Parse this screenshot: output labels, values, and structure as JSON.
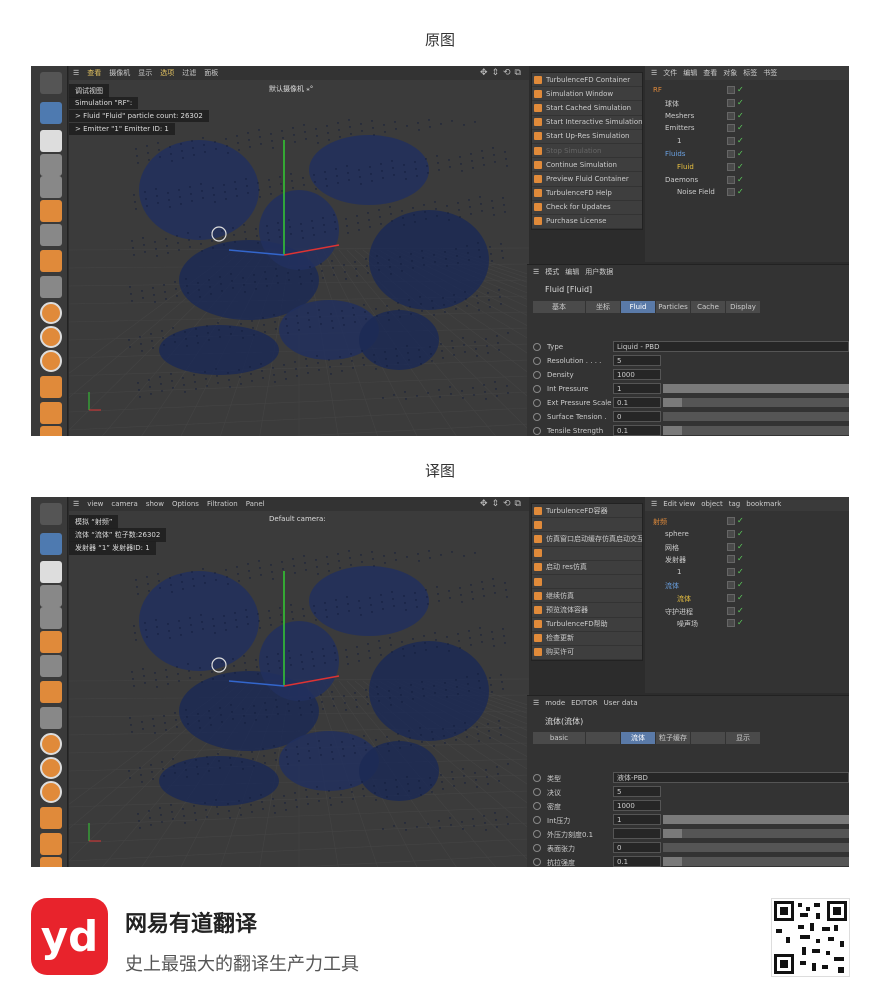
{
  "captions": {
    "original": "原图",
    "translated": "译图"
  },
  "original": {
    "menu": [
      "查看",
      "摄像机",
      "显示",
      "选项",
      "过滤",
      "面板"
    ],
    "menu_active": [
      "查看",
      "选项"
    ],
    "hud": {
      "line1": "调试视图",
      "line2": "Simulation \"RF\":",
      "line3": "> Fluid \"Fluid\" particle count: 26302",
      "line4": "> Emitter \"1\" Emitter ID: 1"
    },
    "camera": "默认摄像机 ⁎°",
    "context_menu": [
      {
        "label": "TurbulenceFD Container",
        "disabled": false
      },
      {
        "label": "Simulation Window",
        "disabled": false
      },
      {
        "label": "Start Cached Simulation",
        "disabled": false
      },
      {
        "label": "Start Interactive Simulation",
        "disabled": false
      },
      {
        "label": "Start Up-Res Simulation",
        "disabled": false
      },
      {
        "label": "Stop Simulation",
        "disabled": true
      },
      {
        "label": "Continue Simulation",
        "disabled": false
      },
      {
        "label": "Preview Fluid Container",
        "disabled": false
      },
      {
        "label": "TurbulenceFD Help",
        "disabled": false
      },
      {
        "label": "Check for Updates",
        "disabled": false
      },
      {
        "label": "Purchase License",
        "disabled": false
      }
    ],
    "obj_menu": [
      "文件",
      "编辑",
      "查看",
      "对象",
      "标签",
      "书签"
    ],
    "objects": [
      {
        "name": "RF",
        "indent": 0,
        "color": "#e08a3a"
      },
      {
        "name": "球体",
        "indent": 1,
        "color": "#ccc"
      },
      {
        "name": "Meshers",
        "indent": 1,
        "color": "#ccc"
      },
      {
        "name": "Emitters",
        "indent": 1,
        "color": "#ccc"
      },
      {
        "name": "1",
        "indent": 2,
        "color": "#ccc"
      },
      {
        "name": "Fluids",
        "indent": 1,
        "color": "#6aa0e0"
      },
      {
        "name": "Fluid",
        "indent": 2,
        "color": "#e8c040"
      },
      {
        "name": "Daemons",
        "indent": 1,
        "color": "#ccc"
      },
      {
        "name": "Noise Field",
        "indent": 2,
        "color": "#ccc"
      }
    ],
    "attr_menu": [
      "模式",
      "编辑",
      "用户数据"
    ],
    "attr_title": "Fluid [Fluid]",
    "tabs": [
      "基本",
      "坐标",
      "Fluid",
      "Particles",
      "Cache",
      "Display"
    ],
    "active_tab": "Fluid",
    "params": [
      {
        "label": "Type",
        "value": "Liquid - PBD",
        "fill": null
      },
      {
        "label": "Resolution . . . .",
        "value": "5",
        "fill": null
      },
      {
        "label": "Density",
        "value": "1000",
        "fill": null
      },
      {
        "label": "Int Pressure",
        "value": "1",
        "fill": 1.0
      },
      {
        "label": "Ext Pressure Scale",
        "value": "0.1",
        "fill": 0.1
      },
      {
        "label": "Surface Tension .",
        "value": "0",
        "fill": 0.0
      },
      {
        "label": "Tensile Strength",
        "value": "0.1",
        "fill": 0.1
      }
    ]
  },
  "translated": {
    "menu": [
      "view",
      "camera",
      "show",
      "Options",
      "Filtration",
      "Panel"
    ],
    "hud": {
      "line1": "模拟 “射频”",
      "line2": "流体 “流体” 粒子数:26302",
      "line3": "发射器 “1” 发射器ID: 1"
    },
    "camera": "Default camera:",
    "context_menu": [
      {
        "label": "TurbulenceFD容器",
        "disabled": false
      },
      {
        "label": "",
        "disabled": false
      },
      {
        "label": "仿真窗口启动缓存仿真启动交互式仿真停止仿真",
        "disabled": false
      },
      {
        "label": "",
        "disabled": false
      },
      {
        "label": "启动 res仿真",
        "disabled": false
      },
      {
        "label": "",
        "disabled": true
      },
      {
        "label": "继续仿真",
        "disabled": false
      },
      {
        "label": "预览流体容器",
        "disabled": false
      },
      {
        "label": "TurbulenceFD帮助",
        "disabled": false
      },
      {
        "label": "检查更新",
        "disabled": false
      },
      {
        "label": "购买许可",
        "disabled": false
      }
    ],
    "obj_menu": [
      "Edit view",
      "object",
      "tag",
      "bookmark"
    ],
    "objects": [
      {
        "name": "射频",
        "indent": 0,
        "color": "#e08a3a"
      },
      {
        "name": "sphere",
        "indent": 1,
        "color": "#ccc"
      },
      {
        "name": "网格",
        "indent": 1,
        "color": "#ccc"
      },
      {
        "name": "发射器",
        "indent": 1,
        "color": "#ccc"
      },
      {
        "name": "1",
        "indent": 2,
        "color": "#ccc"
      },
      {
        "name": "流体",
        "indent": 1,
        "color": "#6aa0e0"
      },
      {
        "name": "流体",
        "indent": 2,
        "color": "#e8c040"
      },
      {
        "name": "守护进程",
        "indent": 1,
        "color": "#ccc"
      },
      {
        "name": "噪声场",
        "indent": 2,
        "color": "#ccc"
      }
    ],
    "attr_menu": [
      "mode",
      "EDITOR",
      "User data"
    ],
    "attr_title": "流体(流体)",
    "tabs": [
      "basic",
      "",
      "流体",
      "粒子缓存",
      "",
      "显示"
    ],
    "active_tab": "流体",
    "params": [
      {
        "label": "类型",
        "value": "液体-PBD",
        "fill": null
      },
      {
        "label": "决议",
        "value": "5",
        "fill": null
      },
      {
        "label": "密度",
        "value": "1000",
        "fill": null
      },
      {
        "label": "Int压力",
        "value": "1",
        "fill": 1.0
      },
      {
        "label": "外压力刻度0.1",
        "value": "",
        "fill": 0.1
      },
      {
        "label": "表面张力",
        "value": "0",
        "fill": 0.0
      },
      {
        "label": "抗拉强度",
        "value": "0.1",
        "fill": 0.1
      }
    ]
  },
  "brand": {
    "name": "网易有道翻译",
    "slogan": "史上最强大的翻译生产力工具",
    "logo_text": "yd"
  }
}
